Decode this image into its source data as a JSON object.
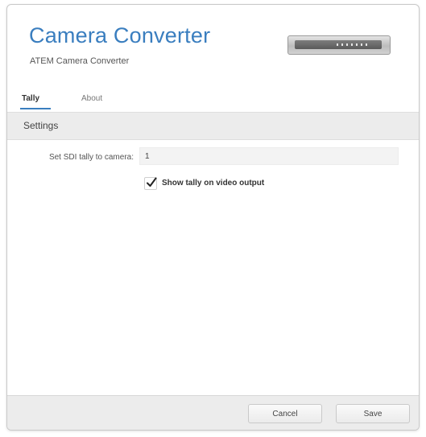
{
  "header": {
    "title": "Camera Converter",
    "subtitle": "ATEM Camera Converter",
    "device_image": "atem-camera-converter-device"
  },
  "tabs": [
    {
      "label": "Tally",
      "active": true
    },
    {
      "label": "About",
      "active": false
    }
  ],
  "section": {
    "title": "Settings"
  },
  "settings": {
    "tally_label": "Set SDI tally to camera:",
    "tally_value": "1",
    "show_tally_label": "Show tally on video output",
    "show_tally_checked": true
  },
  "footer": {
    "cancel_label": "Cancel",
    "save_label": "Save"
  },
  "colors": {
    "accent": "#3a7ebf",
    "section_bg": "#ececec"
  }
}
